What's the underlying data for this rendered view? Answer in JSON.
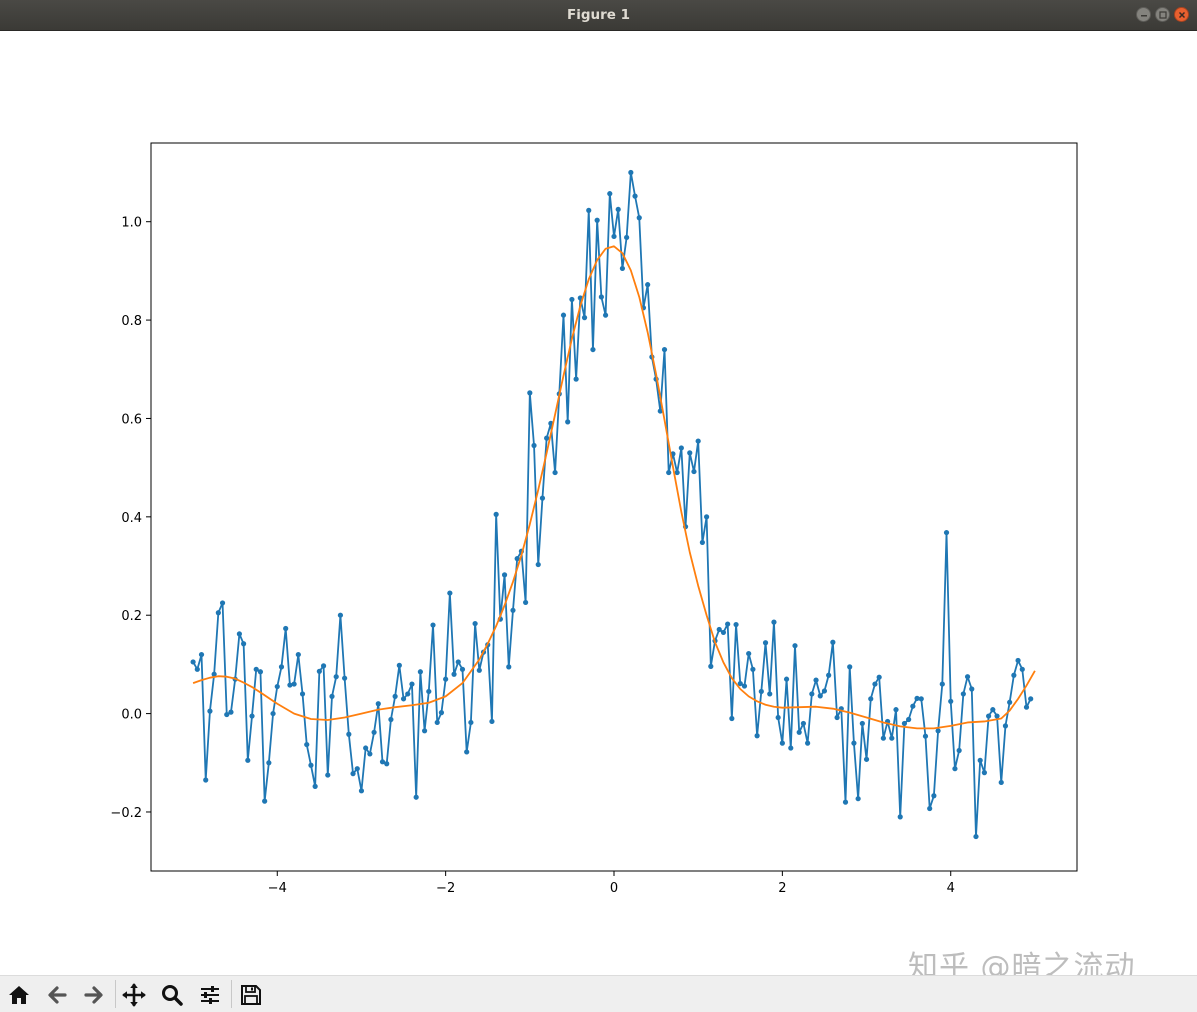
{
  "window": {
    "title": "Figure 1"
  },
  "toolbar": {
    "buttons": [
      "home-icon",
      "back-icon",
      "forward-icon",
      "pan-icon",
      "zoom-icon",
      "configure-subplots-icon",
      "save-icon"
    ]
  },
  "watermark": "知乎 @暗之流动",
  "chart_data": {
    "type": "line",
    "title": "",
    "xlabel": "",
    "ylabel": "",
    "xlim": [
      -5.5,
      5.5
    ],
    "ylim": [
      -0.32,
      1.16
    ],
    "xticks": [
      -4,
      -2,
      0,
      2,
      4
    ],
    "xtick_labels": [
      "−4",
      "−2",
      "0",
      "2",
      "4"
    ],
    "yticks": [
      -0.2,
      0.0,
      0.2,
      0.4,
      0.6,
      0.8,
      1.0
    ],
    "ytick_labels": [
      "−0.2",
      "0.0",
      "0.2",
      "0.4",
      "0.6",
      "0.8",
      "1.0"
    ],
    "grid": false,
    "legend": "none",
    "series": [
      {
        "color": "#1f77b4",
        "marker": "circle",
        "x_start": -5.0,
        "x_step": 0.05,
        "values": [
          0.105,
          0.09,
          0.12,
          -0.135,
          0.005,
          0.08,
          0.205,
          0.225,
          -0.002,
          0.003,
          0.07,
          0.162,
          0.142,
          -0.095,
          -0.005,
          0.09,
          0.085,
          -0.178,
          -0.1,
          0.0,
          0.055,
          0.095,
          0.173,
          0.058,
          0.06,
          0.12,
          0.04,
          -0.063,
          -0.105,
          -0.148,
          0.086,
          0.097,
          -0.125,
          0.035,
          0.075,
          0.2,
          0.072,
          -0.042,
          -0.122,
          -0.112,
          -0.157,
          -0.07,
          -0.082,
          -0.038,
          0.02,
          -0.098,
          -0.102,
          -0.012,
          0.035,
          0.098,
          0.03,
          0.04,
          0.06,
          -0.17,
          0.085,
          -0.035,
          0.045,
          0.18,
          -0.018,
          0.002,
          0.07,
          0.245,
          0.08,
          0.105,
          0.09,
          -0.078,
          -0.018,
          0.183,
          0.088,
          0.125,
          0.14,
          -0.016,
          0.405,
          0.192,
          0.282,
          0.095,
          0.21,
          0.315,
          0.33,
          0.226,
          0.652,
          0.545,
          0.303,
          0.438,
          0.56,
          0.59,
          0.49,
          0.65,
          0.81,
          0.593,
          0.842,
          0.68,
          0.845,
          0.805,
          1.023,
          0.74,
          1.003,
          0.847,
          0.81,
          1.057,
          0.97,
          1.025,
          0.905,
          0.968,
          1.1,
          1.052,
          1.008,
          0.825,
          0.872,
          0.725,
          0.68,
          0.615,
          0.74,
          0.49,
          0.528,
          0.49,
          0.54,
          0.38,
          0.53,
          0.492,
          0.554,
          0.348,
          0.4,
          0.096,
          0.148,
          0.171,
          0.165,
          0.182,
          -0.01,
          0.181,
          0.061,
          0.056,
          0.122,
          0.09,
          -0.045,
          0.045,
          0.144,
          0.04,
          0.186,
          -0.008,
          -0.06,
          0.07,
          -0.07,
          0.138,
          -0.038,
          -0.02,
          -0.06,
          0.04,
          0.068,
          0.036,
          0.046,
          0.078,
          0.145,
          -0.008,
          0.01,
          -0.18,
          0.095,
          -0.06,
          -0.173,
          -0.02,
          -0.093,
          0.03,
          0.06,
          0.074,
          -0.05,
          -0.016,
          -0.05,
          0.008,
          -0.21,
          -0.02,
          -0.012,
          0.015,
          0.031,
          0.03,
          -0.046,
          -0.193,
          -0.167,
          -0.035,
          0.06,
          0.368,
          0.025,
          -0.112,
          -0.075,
          0.04,
          0.075,
          0.05,
          -0.25,
          -0.095,
          -0.12,
          -0.005,
          0.008,
          -0.005,
          -0.14,
          -0.025,
          0.023,
          0.078,
          0.108,
          0.09,
          0.013,
          0.03
        ]
      },
      {
        "color": "#ff7f0e",
        "marker": "none",
        "x": [
          -5.0,
          -4.9,
          -4.8,
          -4.7,
          -4.6,
          -4.5,
          -4.4,
          -4.3,
          -4.2,
          -4.0,
          -3.8,
          -3.6,
          -3.4,
          -3.2,
          -3.0,
          -2.8,
          -2.6,
          -2.4,
          -2.2,
          -2.0,
          -1.8,
          -1.6,
          -1.5,
          -1.4,
          -1.3,
          -1.2,
          -1.1,
          -1.0,
          -0.9,
          -0.8,
          -0.7,
          -0.6,
          -0.5,
          -0.4,
          -0.3,
          -0.2,
          -0.1,
          0.0,
          0.1,
          0.2,
          0.3,
          0.4,
          0.5,
          0.6,
          0.7,
          0.8,
          0.9,
          1.0,
          1.1,
          1.2,
          1.3,
          1.4,
          1.5,
          1.6,
          1.7,
          1.8,
          1.9,
          2.0,
          2.2,
          2.4,
          2.6,
          2.8,
          3.0,
          3.2,
          3.4,
          3.6,
          3.8,
          4.0,
          4.2,
          4.4,
          4.6,
          4.7,
          4.8,
          4.9,
          5.0
        ],
        "values": [
          0.062,
          0.068,
          0.073,
          0.076,
          0.075,
          0.071,
          0.063,
          0.054,
          0.043,
          0.02,
          0.0,
          -0.011,
          -0.013,
          -0.008,
          0.0,
          0.008,
          0.013,
          0.017,
          0.022,
          0.035,
          0.062,
          0.11,
          0.142,
          0.178,
          0.22,
          0.268,
          0.322,
          0.385,
          0.455,
          0.53,
          0.608,
          0.687,
          0.762,
          0.829,
          0.883,
          0.922,
          0.945,
          0.95,
          0.936,
          0.901,
          0.847,
          0.775,
          0.69,
          0.597,
          0.502,
          0.41,
          0.328,
          0.26,
          0.2,
          0.145,
          0.104,
          0.072,
          0.05,
          0.035,
          0.025,
          0.018,
          0.014,
          0.012,
          0.013,
          0.014,
          0.01,
          0.002,
          -0.008,
          -0.018,
          -0.026,
          -0.03,
          -0.03,
          -0.025,
          -0.018,
          -0.016,
          -0.01,
          0.006,
          0.03,
          0.057,
          0.087
        ]
      }
    ]
  }
}
